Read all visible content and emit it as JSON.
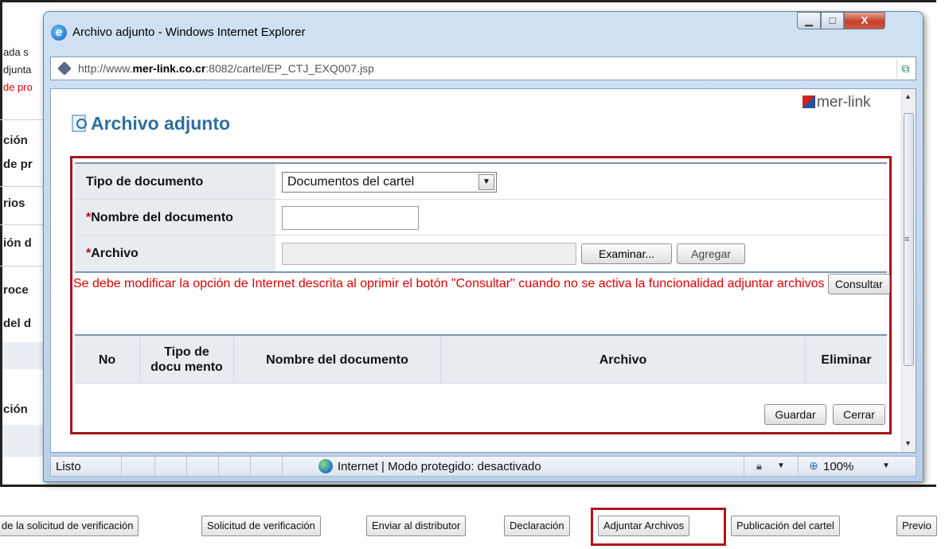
{
  "background": {
    "left_fragments": [
      "ada s",
      "djunta",
      "de pro",
      "ción",
      "de pr",
      "rios",
      "ión d",
      "roce",
      "del d",
      "ción"
    ],
    "bottom_buttons": [
      "de la solicitud de verificación",
      "Solicitud de verificación",
      "Enviar al distributor",
      "Declaración",
      "Adjuntar Archivos",
      "Publicación del cartel",
      "Previo"
    ],
    "highlight_color": "#b3151b"
  },
  "window": {
    "title": "Archivo adjunto - Windows Internet Explorer",
    "icon": "ie-icon",
    "controls": {
      "minimize": "▁",
      "maximize": "□",
      "close": "X"
    },
    "address": {
      "prefix": "http://www.",
      "host": "mer-link.co.cr",
      "suffix": ":8082/cartel/EP_CTJ_EXQ007.jsp"
    }
  },
  "page": {
    "logo_text": "mer-link",
    "title": "Archivo adjunto",
    "form": {
      "tipo_label": "Tipo de documento",
      "tipo_value": "Documentos del cartel",
      "nombre_required": "*",
      "nombre_label": "Nombre del documento",
      "nombre_value": "",
      "archivo_required": "*",
      "archivo_label": "Archivo",
      "examinar": "Examinar...",
      "agregar": "Agregar"
    },
    "warning": "Se debe modificar la opción de Internet descrita al oprimir el botón \"Consultar\" cuando no se activa la funcionalidad adjuntar archivos",
    "consultar": "Consultar",
    "table": {
      "headers": [
        "No",
        "Tipo de docu mento",
        "Nombre del documento",
        "Archivo",
        "Eliminar"
      ],
      "rows": []
    },
    "guardar": "Guardar",
    "cerrar": "Cerrar",
    "accent_color": "#2e6f9e",
    "warning_color": "#e00000"
  },
  "status": {
    "left": "Listo",
    "zone": "Internet | Modo protegido: desactivado",
    "zoom": "100%"
  }
}
